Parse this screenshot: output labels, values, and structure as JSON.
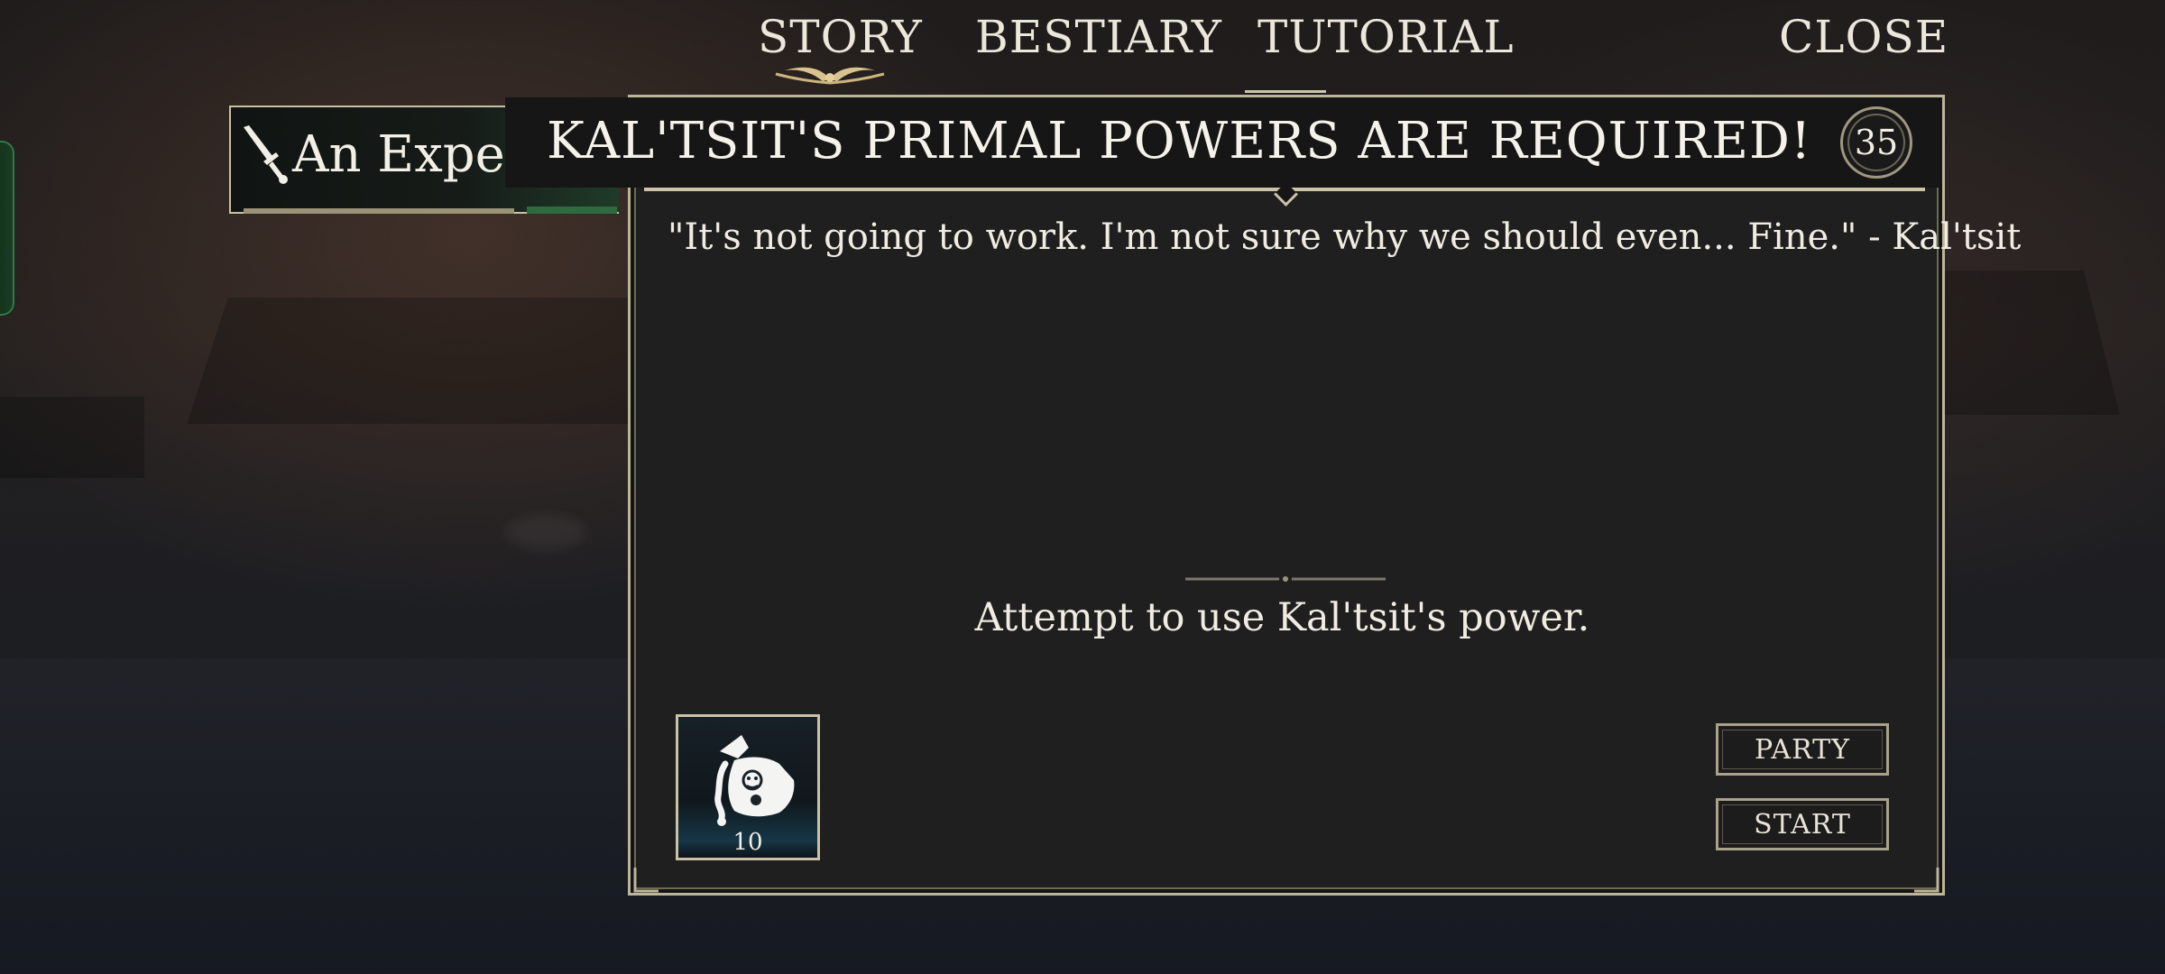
{
  "nav": {
    "tabs": [
      {
        "label": "STORY",
        "active": true
      },
      {
        "label": "BESTIARY",
        "active": false
      },
      {
        "label": "TUTORIAL",
        "active": false
      }
    ],
    "close_label": "CLOSE"
  },
  "quest_tab": {
    "label": "An Expe",
    "icon": "sword-icon"
  },
  "quest": {
    "title": "KAL'TSIT'S PRIMAL POWERS ARE REQUIRED!",
    "level": "35",
    "quote": "\"It's not going to work. I'm not sure why we should even... Fine.\" - Kal'tsit",
    "objective": "Attempt to use Kal'tsit's power."
  },
  "reward": {
    "icon": "coin-pouch-icon",
    "count": "10"
  },
  "buttons": {
    "party": "PARTY",
    "start": "START"
  },
  "colors": {
    "frame": "#bdb59a",
    "panel": "#1f1f1f",
    "text": "#f0ece2",
    "accent_green": "#2f7a45"
  }
}
